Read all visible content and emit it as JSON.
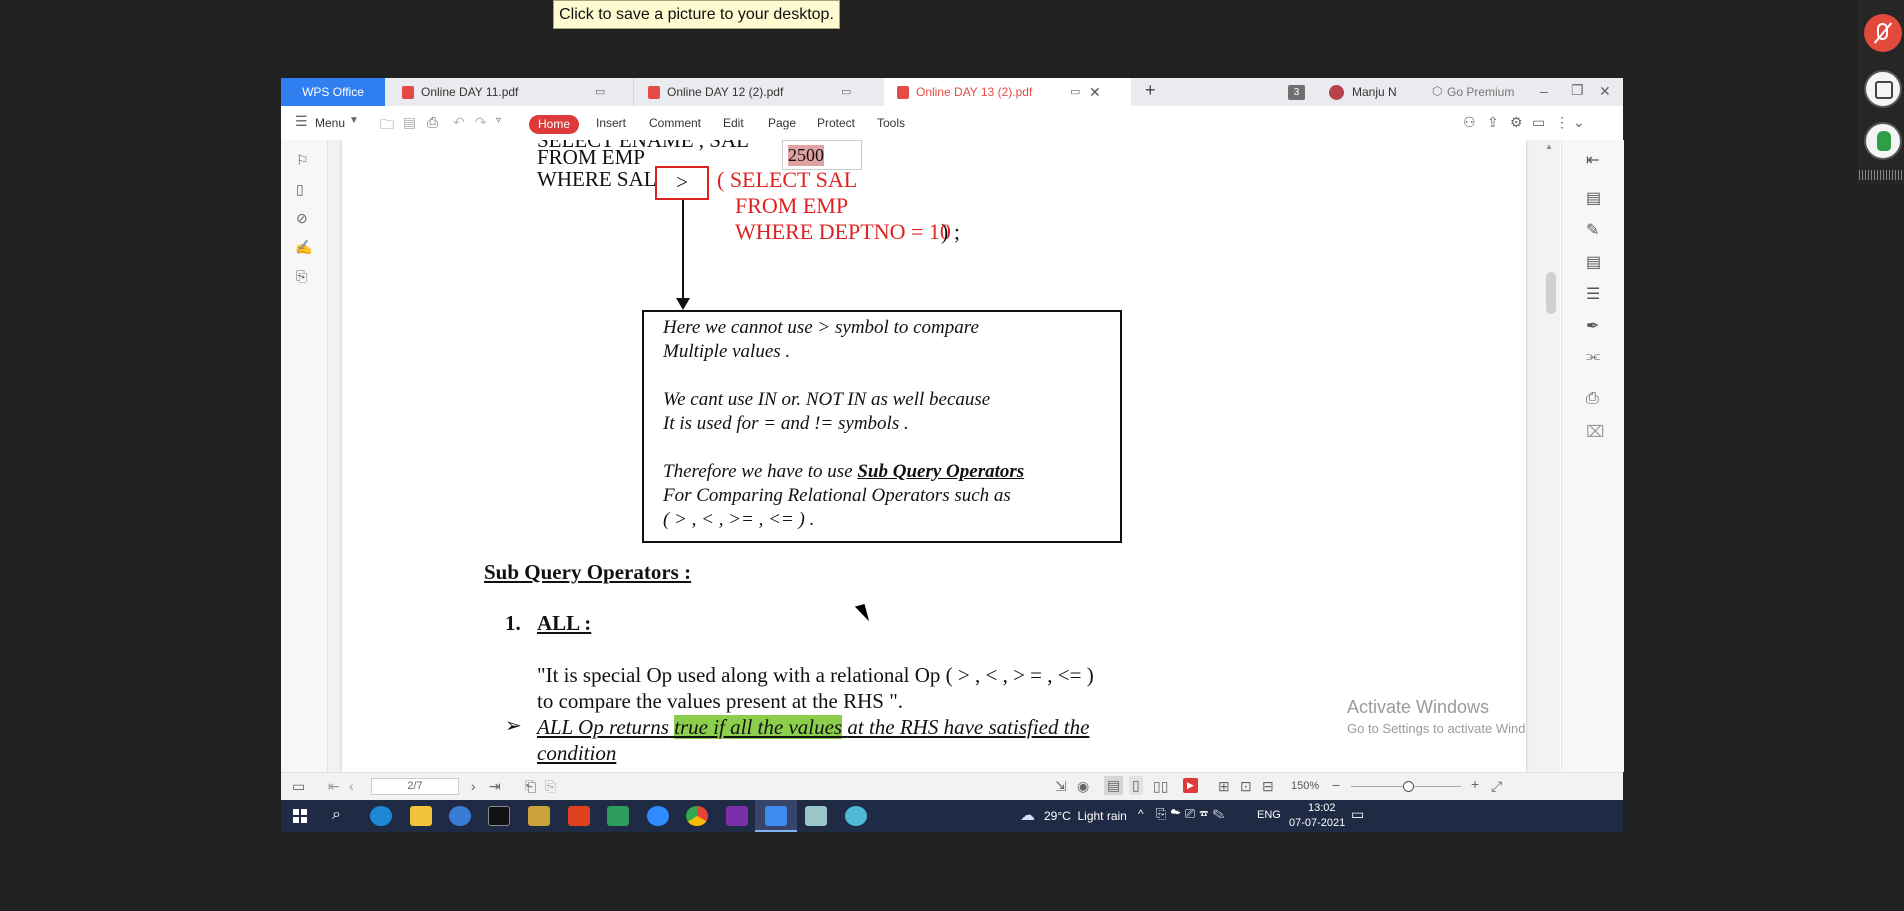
{
  "tooltip": "Click to save a picture to your desktop.",
  "app": {
    "brand": "WPS Office",
    "tabs": [
      {
        "label": "Online DAY 11.pdf"
      },
      {
        "label": "Online DAY 12 (2).pdf"
      },
      {
        "label": "Online DAY 13 (2).pdf"
      }
    ],
    "badge_count": "3",
    "user": "Manju N",
    "premium": "Go Premium"
  },
  "toolbar": {
    "menu": "Menu",
    "home": "Home",
    "insert": "Insert",
    "comment": "Comment",
    "edit": "Edit",
    "page": "Page",
    "protect": "Protect",
    "tools": "Tools"
  },
  "doc": {
    "line_top": "SELECT ENAME , SAL",
    "line_from": "FROM EMP",
    "line_where": "WHERE SAL",
    "value_box": "2500",
    "operator": ">",
    "sub_open": "( SELECT SAL",
    "sub_from": "FROM EMP",
    "sub_where": "WHERE DEPTNO = 10",
    "sub_close": ") ;",
    "note1a": "Here we cannot use > symbol to compare",
    "note1b": "Multiple values .",
    "note2a": "We cant use IN  or. NOT IN as well because",
    "note2b": "It is used for = and != symbols .",
    "note3a": "Therefore we have to use",
    "note3b": "Sub Query Operators",
    "note4": "For Comparing Relational Operators such as",
    "note5": "( > , < , >= , <= ) .",
    "heading": "Sub Query Operators :",
    "item_num": "1.",
    "item_title": "ALL :",
    "desc1": "\"It is special Op used along with a relational Op ( > , < , > = , <= )",
    "desc2": "to compare the values present at the RHS \".",
    "bullet_a": "ALL Op returns",
    "bullet_hl": "true if all the values",
    "bullet_b": "at the RHS have satisfied the",
    "bullet_next": "condition",
    "watermark1": "Activate Windows",
    "watermark2": "Go to Settings to activate Windows."
  },
  "status": {
    "page_input": "2/7",
    "zoom": "150%"
  },
  "taskbar": {
    "weather": "29°C  Light rain",
    "lang": "ENG",
    "time": "13:02",
    "date": "07-07-2021"
  }
}
